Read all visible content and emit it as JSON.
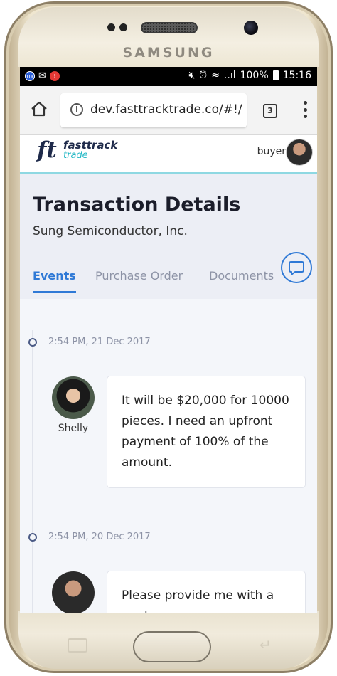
{
  "device": {
    "brand": "SAMSUNG"
  },
  "status_bar": {
    "battery": "100%",
    "time": "15:16",
    "signal_text": "..ıl"
  },
  "browser": {
    "url": "dev.fasttracktrade.co/#!/",
    "tab_count": "3"
  },
  "app_header": {
    "logo_mark": "ft",
    "logo_name": "fasttrack",
    "logo_sub": "trade",
    "role": "buyer"
  },
  "page": {
    "title": "Transaction Details",
    "company": "Sung Semiconductor, Inc.",
    "tabs": [
      "Events",
      "Purchase Order",
      "Documents"
    ]
  },
  "events": [
    {
      "time": "2:54 PM, 21 Dec 2017",
      "sender": "Shelly",
      "message": "It will be $20,000 for 10000 pieces. I need an upfront payment of 100% of the amount."
    },
    {
      "time": "2:54 PM, 20 Dec 2017",
      "sender": "",
      "message": "Please provide me with a quote..."
    }
  ],
  "colors": {
    "accent": "#2f79d6",
    "brand_teal": "#21b7c4",
    "brand_navy": "#1e2a4a"
  }
}
